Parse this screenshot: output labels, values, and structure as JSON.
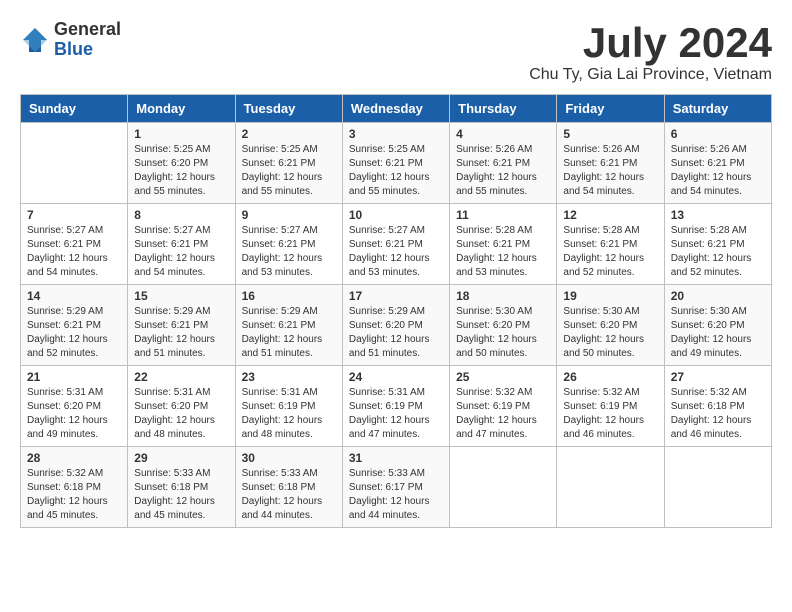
{
  "header": {
    "logo_general": "General",
    "logo_blue": "Blue",
    "month_title": "July 2024",
    "location": "Chu Ty, Gia Lai Province, Vietnam"
  },
  "days_of_week": [
    "Sunday",
    "Monday",
    "Tuesday",
    "Wednesday",
    "Thursday",
    "Friday",
    "Saturday"
  ],
  "weeks": [
    [
      {
        "day": "",
        "info": ""
      },
      {
        "day": "1",
        "info": "Sunrise: 5:25 AM\nSunset: 6:20 PM\nDaylight: 12 hours\nand 55 minutes."
      },
      {
        "day": "2",
        "info": "Sunrise: 5:25 AM\nSunset: 6:21 PM\nDaylight: 12 hours\nand 55 minutes."
      },
      {
        "day": "3",
        "info": "Sunrise: 5:25 AM\nSunset: 6:21 PM\nDaylight: 12 hours\nand 55 minutes."
      },
      {
        "day": "4",
        "info": "Sunrise: 5:26 AM\nSunset: 6:21 PM\nDaylight: 12 hours\nand 55 minutes."
      },
      {
        "day": "5",
        "info": "Sunrise: 5:26 AM\nSunset: 6:21 PM\nDaylight: 12 hours\nand 54 minutes."
      },
      {
        "day": "6",
        "info": "Sunrise: 5:26 AM\nSunset: 6:21 PM\nDaylight: 12 hours\nand 54 minutes."
      }
    ],
    [
      {
        "day": "7",
        "info": "Sunrise: 5:27 AM\nSunset: 6:21 PM\nDaylight: 12 hours\nand 54 minutes."
      },
      {
        "day": "8",
        "info": "Sunrise: 5:27 AM\nSunset: 6:21 PM\nDaylight: 12 hours\nand 54 minutes."
      },
      {
        "day": "9",
        "info": "Sunrise: 5:27 AM\nSunset: 6:21 PM\nDaylight: 12 hours\nand 53 minutes."
      },
      {
        "day": "10",
        "info": "Sunrise: 5:27 AM\nSunset: 6:21 PM\nDaylight: 12 hours\nand 53 minutes."
      },
      {
        "day": "11",
        "info": "Sunrise: 5:28 AM\nSunset: 6:21 PM\nDaylight: 12 hours\nand 53 minutes."
      },
      {
        "day": "12",
        "info": "Sunrise: 5:28 AM\nSunset: 6:21 PM\nDaylight: 12 hours\nand 52 minutes."
      },
      {
        "day": "13",
        "info": "Sunrise: 5:28 AM\nSunset: 6:21 PM\nDaylight: 12 hours\nand 52 minutes."
      }
    ],
    [
      {
        "day": "14",
        "info": "Sunrise: 5:29 AM\nSunset: 6:21 PM\nDaylight: 12 hours\nand 52 minutes."
      },
      {
        "day": "15",
        "info": "Sunrise: 5:29 AM\nSunset: 6:21 PM\nDaylight: 12 hours\nand 51 minutes."
      },
      {
        "day": "16",
        "info": "Sunrise: 5:29 AM\nSunset: 6:21 PM\nDaylight: 12 hours\nand 51 minutes."
      },
      {
        "day": "17",
        "info": "Sunrise: 5:29 AM\nSunset: 6:20 PM\nDaylight: 12 hours\nand 51 minutes."
      },
      {
        "day": "18",
        "info": "Sunrise: 5:30 AM\nSunset: 6:20 PM\nDaylight: 12 hours\nand 50 minutes."
      },
      {
        "day": "19",
        "info": "Sunrise: 5:30 AM\nSunset: 6:20 PM\nDaylight: 12 hours\nand 50 minutes."
      },
      {
        "day": "20",
        "info": "Sunrise: 5:30 AM\nSunset: 6:20 PM\nDaylight: 12 hours\nand 49 minutes."
      }
    ],
    [
      {
        "day": "21",
        "info": "Sunrise: 5:31 AM\nSunset: 6:20 PM\nDaylight: 12 hours\nand 49 minutes."
      },
      {
        "day": "22",
        "info": "Sunrise: 5:31 AM\nSunset: 6:20 PM\nDaylight: 12 hours\nand 48 minutes."
      },
      {
        "day": "23",
        "info": "Sunrise: 5:31 AM\nSunset: 6:19 PM\nDaylight: 12 hours\nand 48 minutes."
      },
      {
        "day": "24",
        "info": "Sunrise: 5:31 AM\nSunset: 6:19 PM\nDaylight: 12 hours\nand 47 minutes."
      },
      {
        "day": "25",
        "info": "Sunrise: 5:32 AM\nSunset: 6:19 PM\nDaylight: 12 hours\nand 47 minutes."
      },
      {
        "day": "26",
        "info": "Sunrise: 5:32 AM\nSunset: 6:19 PM\nDaylight: 12 hours\nand 46 minutes."
      },
      {
        "day": "27",
        "info": "Sunrise: 5:32 AM\nSunset: 6:18 PM\nDaylight: 12 hours\nand 46 minutes."
      }
    ],
    [
      {
        "day": "28",
        "info": "Sunrise: 5:32 AM\nSunset: 6:18 PM\nDaylight: 12 hours\nand 45 minutes."
      },
      {
        "day": "29",
        "info": "Sunrise: 5:33 AM\nSunset: 6:18 PM\nDaylight: 12 hours\nand 45 minutes."
      },
      {
        "day": "30",
        "info": "Sunrise: 5:33 AM\nSunset: 6:18 PM\nDaylight: 12 hours\nand 44 minutes."
      },
      {
        "day": "31",
        "info": "Sunrise: 5:33 AM\nSunset: 6:17 PM\nDaylight: 12 hours\nand 44 minutes."
      },
      {
        "day": "",
        "info": ""
      },
      {
        "day": "",
        "info": ""
      },
      {
        "day": "",
        "info": ""
      }
    ]
  ]
}
